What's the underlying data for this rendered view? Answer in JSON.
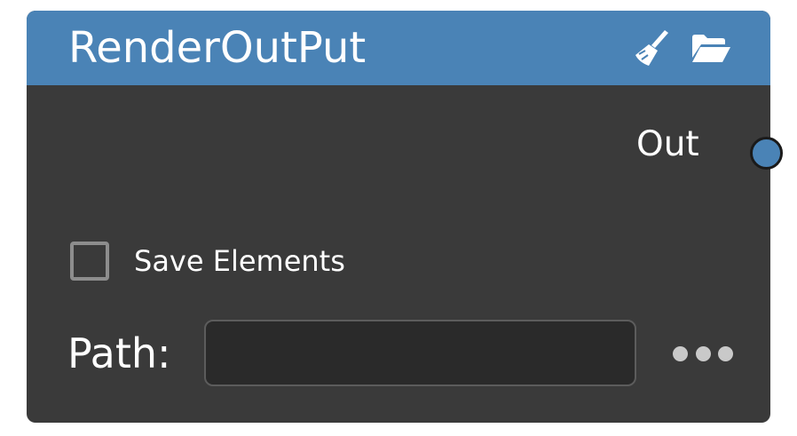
{
  "node": {
    "title": "RenderOutPut",
    "header_icons": [
      "clear-brush-icon",
      "folder-open-icon"
    ],
    "header_color": "#4a83b6",
    "body_color": "#3a3a3a"
  },
  "output_port": {
    "label": "Out",
    "color": "#4a83b6"
  },
  "save_elements": {
    "label": "Save Elements",
    "checked": false
  },
  "path": {
    "label": "Path:",
    "value": "",
    "browse_icon": "ellipsis-icon"
  }
}
